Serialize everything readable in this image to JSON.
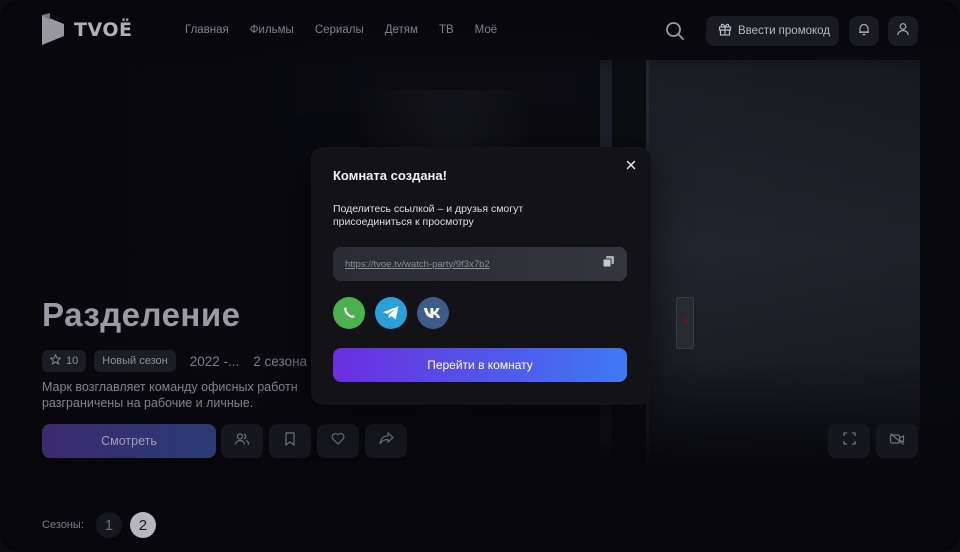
{
  "header": {
    "logo_text": "TVOЁ",
    "nav": [
      "Главная",
      "Фильмы",
      "Сериалы",
      "Детям",
      "ТВ",
      "Моё"
    ],
    "promo_label": "Ввести промокод"
  },
  "show": {
    "title": "Разделение",
    "rating": "10",
    "badge": "Новый сезон",
    "years": "2022 -...",
    "seasons_count": "2 сезона",
    "description": "Марк возглавляет команду офисных работн разграничены на рабочие и личные.",
    "watch_label": "Смотреть"
  },
  "seasons": {
    "label": "Сезоны:",
    "items": [
      "1",
      "2"
    ],
    "selected": "2"
  },
  "modal": {
    "title": "Комната создана!",
    "subtitle": "Поделитесь ссылкой – и друзья смогут присоединиться к просмотру",
    "link": "https://tvoe.tv/watch-party/9f3x7b2",
    "socials": [
      "whatsapp-icon",
      "telegram-icon",
      "vk-icon"
    ],
    "goto_label": "Перейти в комнату"
  },
  "colors": {
    "accent_start": "#6a2ee0",
    "accent_end": "#3e79f2",
    "whatsapp": "#4caf50",
    "telegram": "#2a9fd8",
    "vk": "#3d5c8a"
  }
}
